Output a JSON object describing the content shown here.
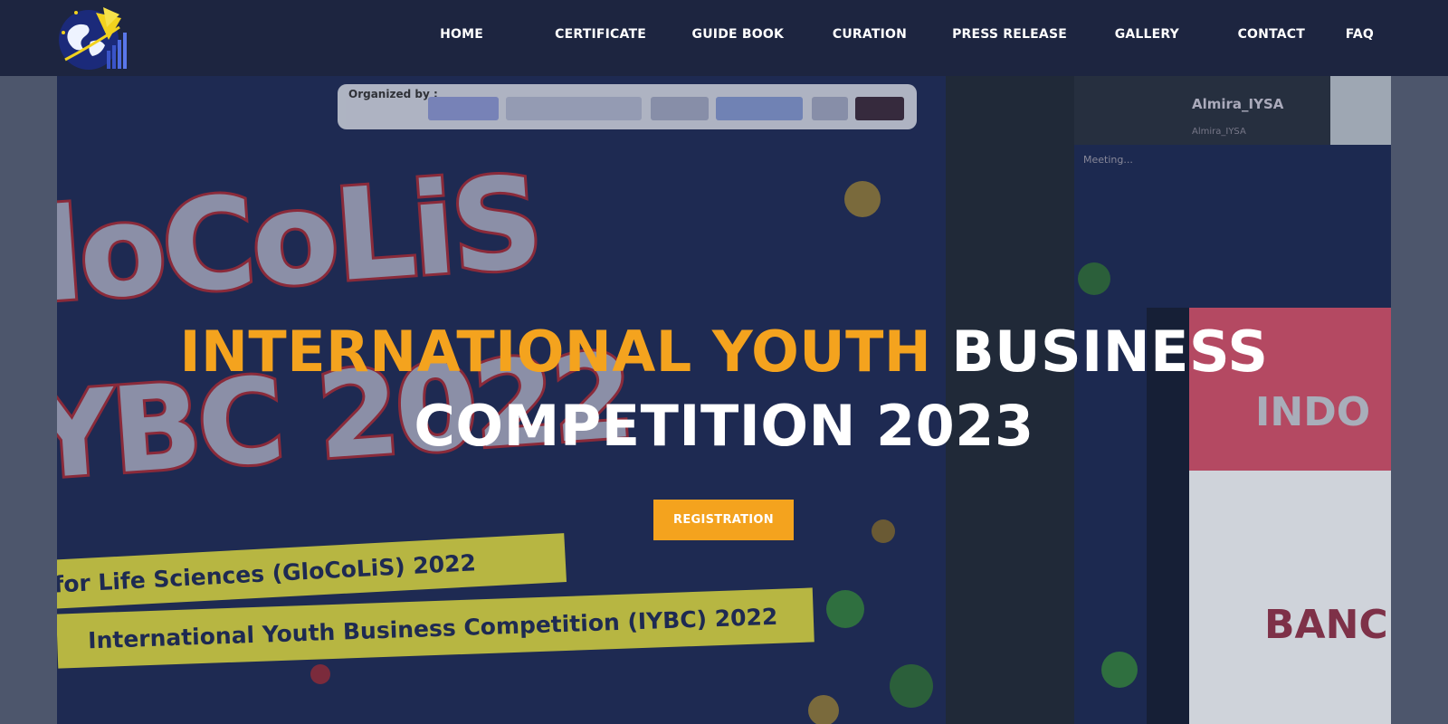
{
  "header": {
    "logo_alt": "IYSA logo",
    "nav": [
      {
        "label": "HOME"
      },
      {
        "label": "CERTIFICATE"
      },
      {
        "label": "GUIDE BOOK"
      },
      {
        "label": "CURATION"
      },
      {
        "label": "PRESS RELEASE"
      },
      {
        "label": "GALLERY"
      },
      {
        "label": "CONTACT"
      },
      {
        "label": "FAQ"
      }
    ]
  },
  "hero": {
    "title_accent": "INTERNATIONAL YOUTH",
    "title_rest_line1": "BUSINESS",
    "title_line2": "COMPETITION 2023",
    "button_label": "REGISTRATION",
    "background": {
      "organized_by": "Organized by :",
      "bg_title_1": "loCoLiS",
      "bg_title_2": "YBC 2022",
      "ribbon_1": "for Life Sciences (GloCoLiS) 2022",
      "ribbon_2": "International Youth Business Competition (IYBC) 2022",
      "side_name": "Almira_IYSA",
      "side_sub": "Almira_IYSA",
      "side_meeting": "Meeting...",
      "flag_text_1": "INDO",
      "flag_text_2": "BANC"
    }
  },
  "colors": {
    "header_bg": "#1d2540",
    "accent": "#f4a31e",
    "text": "#ffffff"
  }
}
